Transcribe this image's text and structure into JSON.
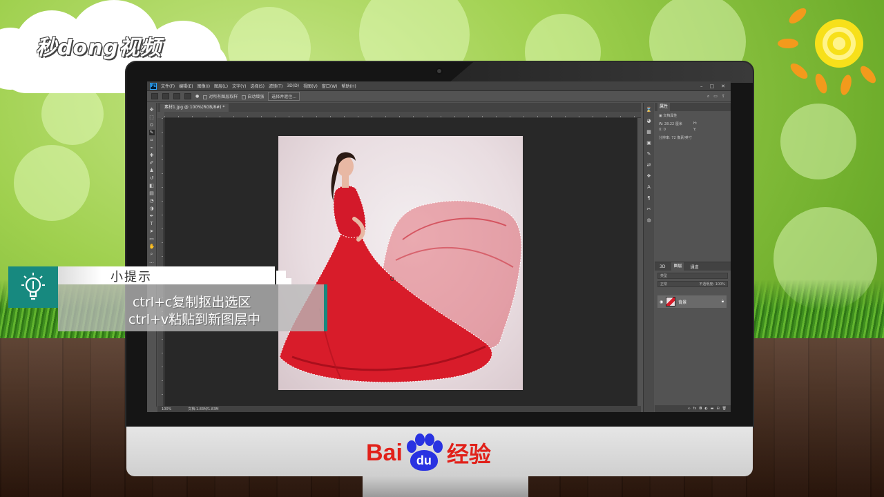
{
  "branding": {
    "watermark": "秒dong视频",
    "footer_brand_latin": "Bai",
    "footer_brand_paw": "du",
    "footer_brand_cn": "经验"
  },
  "photoshop": {
    "menu": [
      "文件(F)",
      "编辑(E)",
      "图像(I)",
      "图层(L)",
      "文字(Y)",
      "选择(S)",
      "滤镜(T)",
      "3D(D)",
      "视图(V)",
      "窗口(W)",
      "帮助(H)"
    ],
    "options_bar": {
      "sample_all_layers": "对所有图层取样",
      "auto_enhance": "自动增强",
      "select_subject_button": "选择并遮住..."
    },
    "document_tab": "素材1.jpg @ 100%(RGB/8#) *",
    "status_zoom": "100%",
    "status_doc": "文档:1.83M/1.83M",
    "properties": {
      "tab": "属性",
      "section": "文档属性",
      "w_label": "W: 28.22 厘米",
      "h_label": "H:",
      "x_label": "X: 0",
      "y_label": "Y:",
      "resolution": "分辨率: 72 像素/英寸"
    },
    "layers_panel": {
      "tabs": [
        "3D",
        "图层",
        "通道"
      ],
      "active_tab": "图层",
      "filter_placeholder": "类型",
      "blend_mode": "正常",
      "opacity": "不透明度: 100%",
      "layer_name": "背景"
    }
  },
  "tip": {
    "title": "小提示",
    "line1": "ctrl+c复制抠出选区",
    "line2": "ctrl+v粘贴到新图层中"
  },
  "colors": {
    "accent_teal": "#17897f",
    "baidu_red": "#e1211a",
    "baidu_blue": "#2932e1",
    "dress_red": "#d81c2a"
  }
}
